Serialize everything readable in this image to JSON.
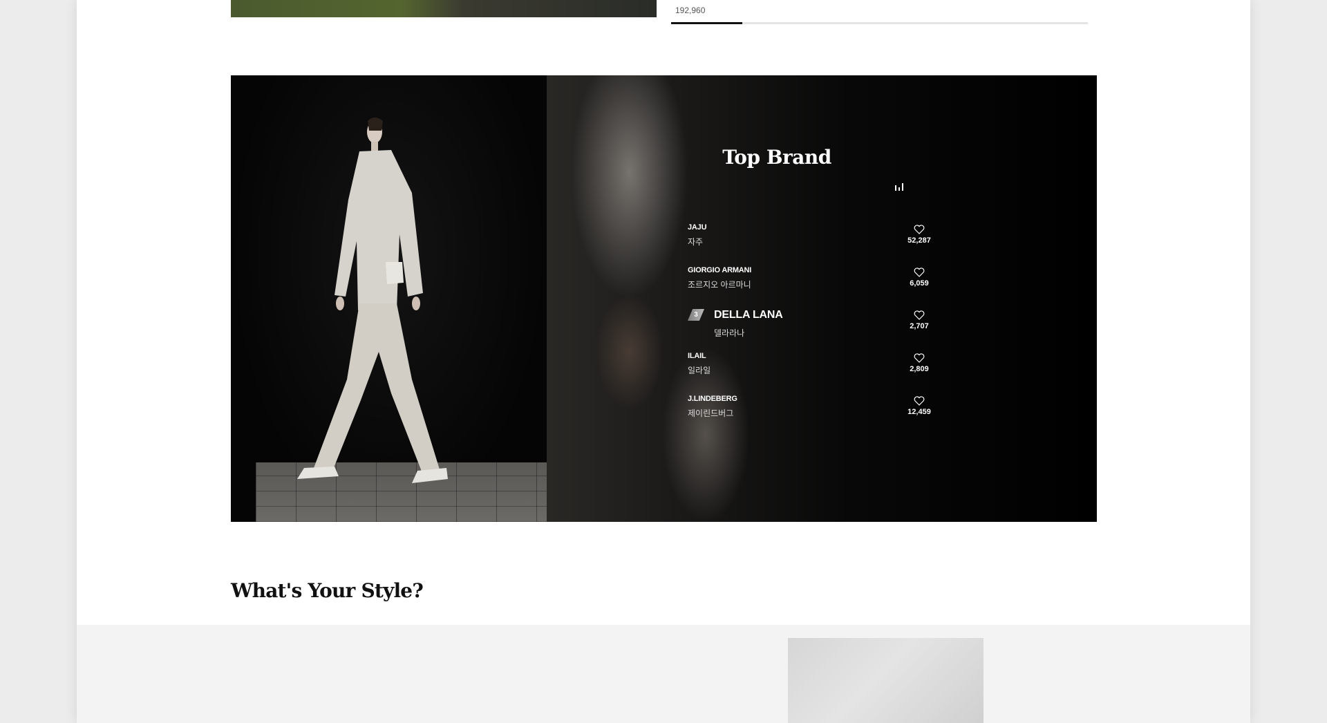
{
  "top": {
    "price": "192,960",
    "progress": 0.17
  },
  "top_brand": {
    "title": "Top Brand",
    "items": [
      {
        "rank": "",
        "name_en": "JAJU",
        "name_ko": "자주",
        "likes": "52,287"
      },
      {
        "rank": "",
        "name_en": "GIORGIO ARMANI",
        "name_ko": "조르지오 아르마니",
        "likes": "6,059"
      },
      {
        "rank": "3",
        "name_en": "DELLA LANA",
        "name_ko": "델라라나",
        "likes": "2,707",
        "active": true
      },
      {
        "rank": "",
        "name_en": "ILAIL",
        "name_ko": "일라일",
        "likes": "2,809"
      },
      {
        "rank": "",
        "name_en": "J.LINDEBERG",
        "name_ko": "제이린드버그",
        "likes": "12,459"
      }
    ],
    "icons": {
      "chart": "bar-chart-icon",
      "like": "heart-icon"
    }
  },
  "style": {
    "title": "What's Your Style?"
  },
  "colors": {
    "page_bg": "#ffffff",
    "outer_bg": "#ececec",
    "banner_bg": "#000000",
    "section_bg": "#f3f3f3"
  }
}
